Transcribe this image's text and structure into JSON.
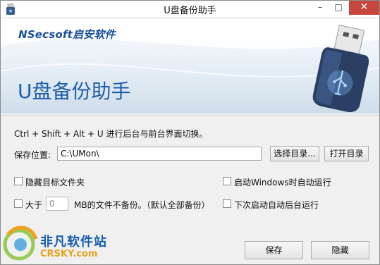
{
  "window": {
    "title": "U盘备份助手",
    "minimize": "–",
    "maximize": "□",
    "close": "✕"
  },
  "banner": {
    "logo": "NSecsoft启安软件",
    "title": "U盘备份助手",
    "device_icon": "usb-drive-icon"
  },
  "hint": "Ctrl + Shift + Alt + U 进行后台与前台界面切换。",
  "save_location": {
    "label": "保存位置:",
    "value": "C:\\UMon\\",
    "browse_button": "选择目录...",
    "open_button": "打开目录"
  },
  "options": {
    "hide_target_folder": {
      "label": "隐藏目标文件夹",
      "checked": false
    },
    "auto_run_on_start": {
      "label": "启动Windows时自动运行",
      "checked": false
    },
    "size_limit": {
      "prefix": "大于",
      "value": "0",
      "suffix": "MB的文件不备份。（默认全部备份）",
      "checked": false
    },
    "next_start_background": {
      "label": "下次启动自动后台运行",
      "checked": false
    }
  },
  "buttons": {
    "save": "保存",
    "hide": "隐藏"
  },
  "watermark": {
    "cn": "非凡软件站",
    "en": "CRSKY.com"
  },
  "colors": {
    "accent": "#1f5ea8",
    "close_button": "#c7463e"
  }
}
